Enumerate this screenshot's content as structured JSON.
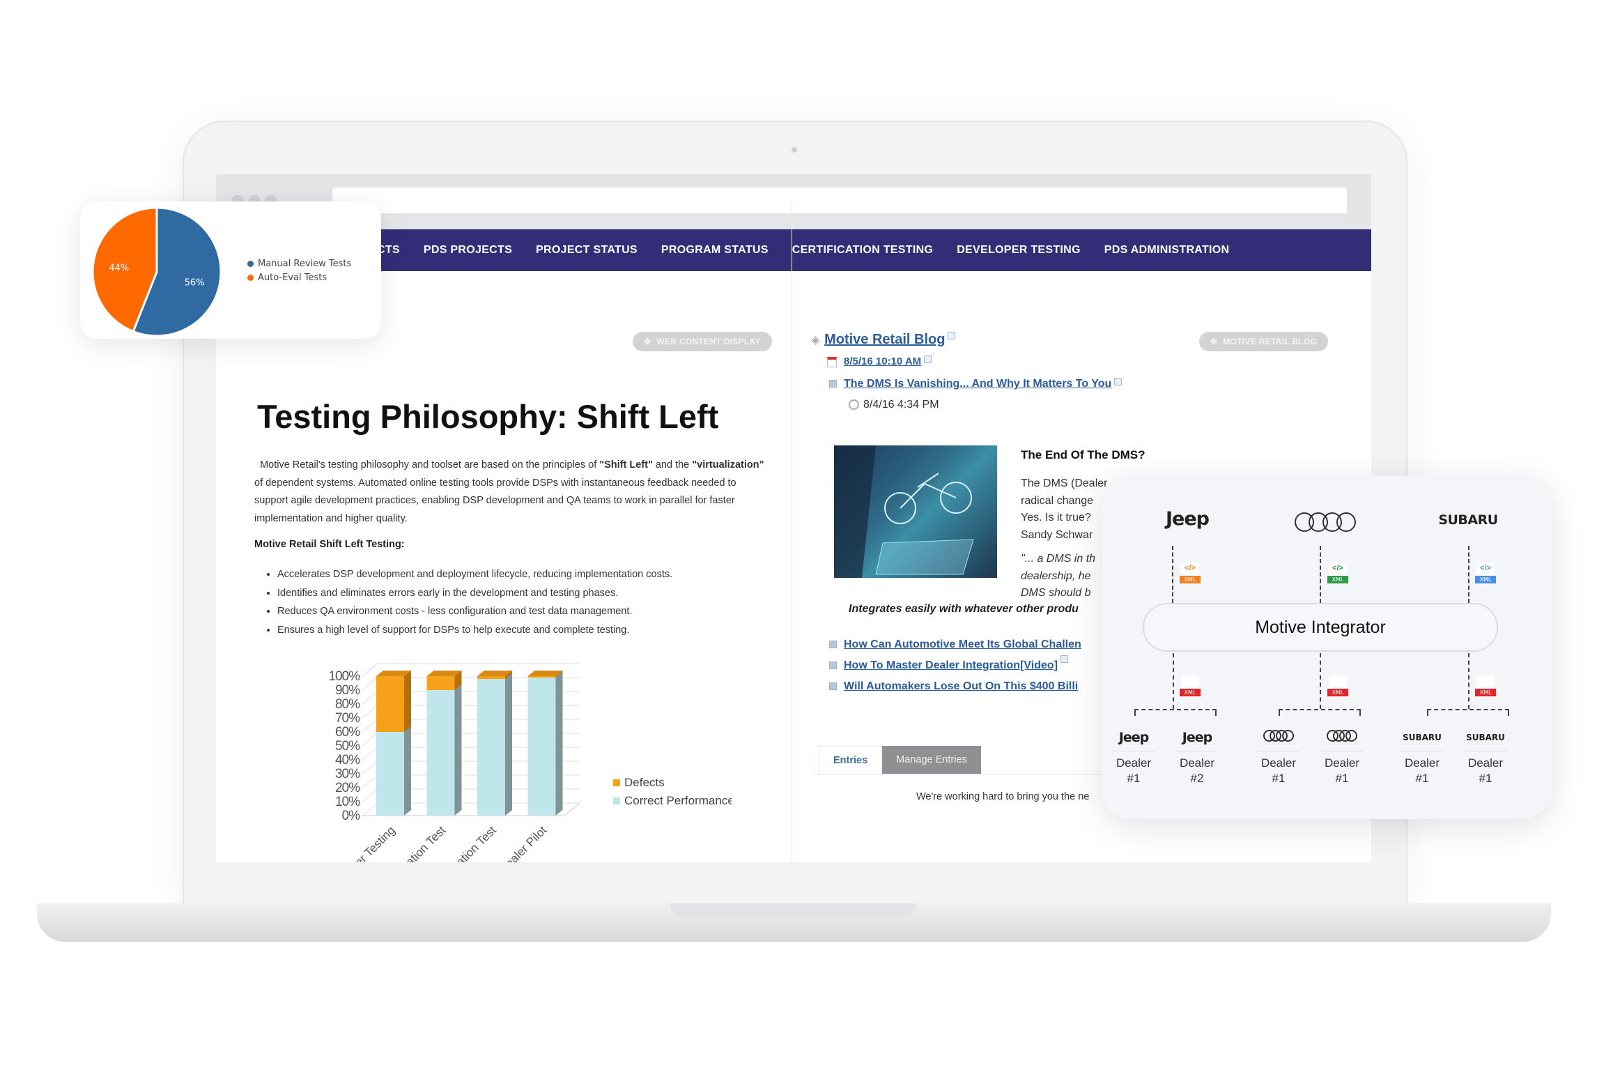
{
  "nav": {
    "items": [
      "ECTS",
      "PDS PROJECTS",
      "PROJECT STATUS",
      "PROGRAM STATUS",
      "CERTIFICATION TESTING",
      "DEVELOPER TESTING",
      "PDS ADMINISTRATION"
    ]
  },
  "colors": {
    "nav_bg": "#332d78",
    "link": "#2a5d9a",
    "pie_blue": "#2f6aa3",
    "pie_orange": "#ff6a00",
    "defects": "#f7a11a",
    "correct": "#bfe6ea"
  },
  "left": {
    "pill_label": "WEB CONTENT DISPLAY",
    "pill_icon": "move-icon",
    "title": "Testing Philosophy: Shift Left",
    "para": {
      "p1": "Motive Retail's testing philosophy and toolset are based on the principles of ",
      "b1": "\"Shift Left\"",
      "p2": " and the ",
      "b2": "\"virtualization\"",
      "p3": " of dependent systems. Automated online testing tools provide DSPs with instantaneous feedback needed to support agile development practices, enabling DSP development and QA teams to work in parallel for faster implementation and higher quality."
    },
    "subhead": "Motive Retail Shift Left Testing:",
    "bullets": [
      "Accelerates DSP development and deployment lifecycle, reducing implementation costs.",
      "Identifies and eliminates errors early in the development and testing phases.",
      "Reduces QA environment costs - less configuration and test data management.",
      "Ensures a high level of support for DSPs to help execute and complete testing."
    ]
  },
  "blog": {
    "pill_label": "MOTIVE RETAIL BLOG",
    "title": "Motive Retail Blog",
    "date_link": "8/5/16 10:10 AM",
    "entry_title": "The DMS Is Vanishing... And Why It Matters To You",
    "entry_time": "8/4/16 4:34 PM",
    "article_heading": "The End Of The DMS?",
    "article_lines": [
      "The DMS (Dealer",
      "radical change",
      "Yes. Is it true?",
      "Sandy Schwar"
    ],
    "quote_lines": [
      "\"... a DMS in th",
      "dealership, he",
      "DMS should b"
    ],
    "tagline": "Integrates easily with whatever other produ",
    "links": [
      "How Can Automotive Meet Its Global Challen",
      "How To Master Dealer Integration[Video]",
      "Will Automakers Lose Out On This $400 Billi"
    ],
    "tabs": [
      "Entries",
      "Manage Entries"
    ],
    "footer_text": "We're working hard to bring you the ne"
  },
  "chart_data": [
    {
      "type": "pie",
      "slices": [
        {
          "name": "Manual Review Tests",
          "value": 56,
          "label": "56%"
        },
        {
          "name": "Auto-Eval Tests",
          "value": 44,
          "label": "44%"
        }
      ],
      "legend": "right"
    },
    {
      "type": "bar",
      "stacked": true,
      "style": "3d",
      "categories": [
        "Developer Testing",
        "Certification Test",
        "Certification Test",
        "Dealer Pilot"
      ],
      "series": [
        {
          "name": "Correct Performance",
          "values": [
            60,
            90,
            98,
            99
          ]
        },
        {
          "name": "Defects",
          "values": [
            40,
            10,
            2,
            1
          ]
        }
      ],
      "yticks": [
        "0%",
        "10%",
        "20%",
        "30%",
        "40%",
        "50%",
        "60%",
        "70%",
        "80%",
        "90%",
        "100%"
      ],
      "ylim": [
        0,
        100
      ],
      "grid": true,
      "legend": "right"
    }
  ],
  "diagram": {
    "top_brands": [
      "Jeep",
      "Audi",
      "SUBARU"
    ],
    "top_badge_colors": [
      "#f58220",
      "#2e9a47",
      "#4a8fe8"
    ],
    "bottom_badge_color": "#e0262b",
    "badge_label": "XML",
    "code_glyph": "</>",
    "integrator": "Motive Integrator",
    "dealers": [
      {
        "brand": "Jeep",
        "line1": "Dealer",
        "line2": "#1"
      },
      {
        "brand": "Jeep",
        "line1": "Dealer",
        "line2": "#2"
      },
      {
        "brand": "Audi",
        "line1": "Dealer",
        "line2": "#1"
      },
      {
        "brand": "Audi",
        "line1": "Dealer",
        "line2": "#1"
      },
      {
        "brand": "SUBARU",
        "line1": "Dealer",
        "line2": "#1"
      },
      {
        "brand": "SUBARU",
        "line1": "Dealer",
        "line2": "#1"
      }
    ]
  }
}
